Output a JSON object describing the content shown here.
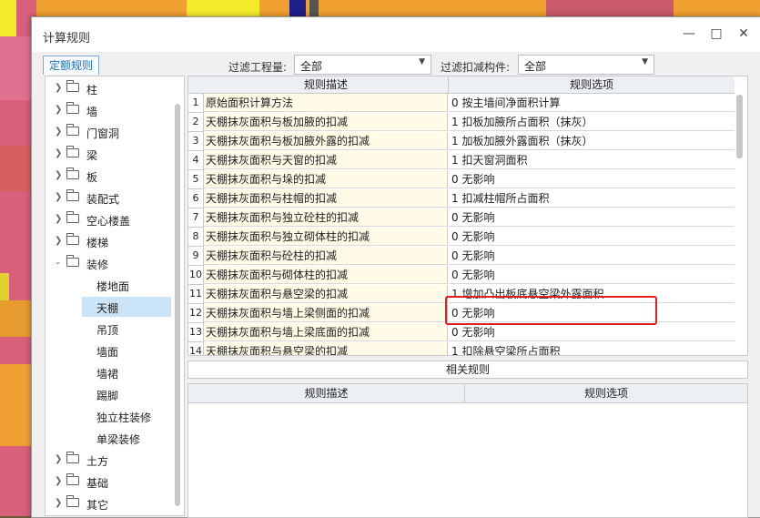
{
  "window": {
    "title": "计算规则"
  },
  "tabs": {
    "active": "定额规则"
  },
  "filters": {
    "project_label": "过滤工程量:",
    "project_value": "全部",
    "component_label": "过滤扣减构件:",
    "component_value": "全部"
  },
  "tree": {
    "items": [
      {
        "label": "柱",
        "expanded": false
      },
      {
        "label": "墙",
        "expanded": false
      },
      {
        "label": "门窗洞",
        "expanded": false
      },
      {
        "label": "梁",
        "expanded": false
      },
      {
        "label": "板",
        "expanded": false
      },
      {
        "label": "装配式",
        "expanded": false
      },
      {
        "label": "空心楼盖",
        "expanded": false
      },
      {
        "label": "楼梯",
        "expanded": false
      },
      {
        "label": "装修",
        "expanded": true
      }
    ],
    "children": [
      {
        "label": "楼地面",
        "selected": false
      },
      {
        "label": "天棚",
        "selected": true
      },
      {
        "label": "吊顶",
        "selected": false
      },
      {
        "label": "墙面",
        "selected": false
      },
      {
        "label": "墙裙",
        "selected": false
      },
      {
        "label": "踢脚",
        "selected": false
      },
      {
        "label": "独立柱装修",
        "selected": false
      },
      {
        "label": "单梁装修",
        "selected": false
      }
    ],
    "after": [
      {
        "label": "土方",
        "expanded": false
      },
      {
        "label": "基础",
        "expanded": false
      },
      {
        "label": "其它",
        "expanded": false
      }
    ]
  },
  "rules_table": {
    "headers": [
      "规则描述",
      "规则选项"
    ],
    "rows": [
      {
        "num": "1",
        "desc": "原始面积计算方法",
        "opt": "0 按主墙间净面积计算"
      },
      {
        "num": "2",
        "desc": "天棚抹灰面积与板加腋的扣减",
        "opt": "1 扣板加腋所占面积（抹灰）"
      },
      {
        "num": "3",
        "desc": "天棚抹灰面积与板加腋外露的扣减",
        "opt": "1 加板加腋外露面积（抹灰）"
      },
      {
        "num": "4",
        "desc": "天棚抹灰面积与天窗的扣减",
        "opt": "1 扣天窗洞面积"
      },
      {
        "num": "5",
        "desc": "天棚抹灰面积与垛的扣减",
        "opt": "0   无影响"
      },
      {
        "num": "6",
        "desc": "天棚抹灰面积与柱帽的扣减",
        "opt": "1 扣减柱帽所占面积"
      },
      {
        "num": "7",
        "desc": "天棚抹灰面积与独立砼柱的扣减",
        "opt": "0   无影响"
      },
      {
        "num": "8",
        "desc": "天棚抹灰面积与独立砌体柱的扣减",
        "opt": "0   无影响"
      },
      {
        "num": "9",
        "desc": "天棚抹灰面积与砼柱的扣减",
        "opt": "0   无影响"
      },
      {
        "num": "10",
        "desc": "天棚抹灰面积与砌体柱的扣减",
        "opt": "0   无影响"
      },
      {
        "num": "11",
        "desc": "天棚抹灰面积与悬空梁的扣减",
        "opt": "1 增加凸出板底悬空梁外露面积"
      },
      {
        "num": "12",
        "desc": "天棚抹灰面积与墙上梁侧面的扣减",
        "opt": "0   无影响"
      },
      {
        "num": "13",
        "desc": "天棚抹灰面积与墙上梁底面的扣减",
        "opt": "0   无影响"
      },
      {
        "num": "14",
        "desc": "天棚抹灰面积与悬空梁的扣减",
        "opt": "1 扣除悬空梁所占面积"
      }
    ]
  },
  "related": {
    "button_label": "相关规则",
    "headers": [
      "规则描述",
      "规则选项"
    ]
  },
  "colors": {
    "highlight": "#e02020",
    "selected": "#cce4f7",
    "desc_bg": "#fffbe6",
    "tab_text": "#1f6fc4"
  }
}
